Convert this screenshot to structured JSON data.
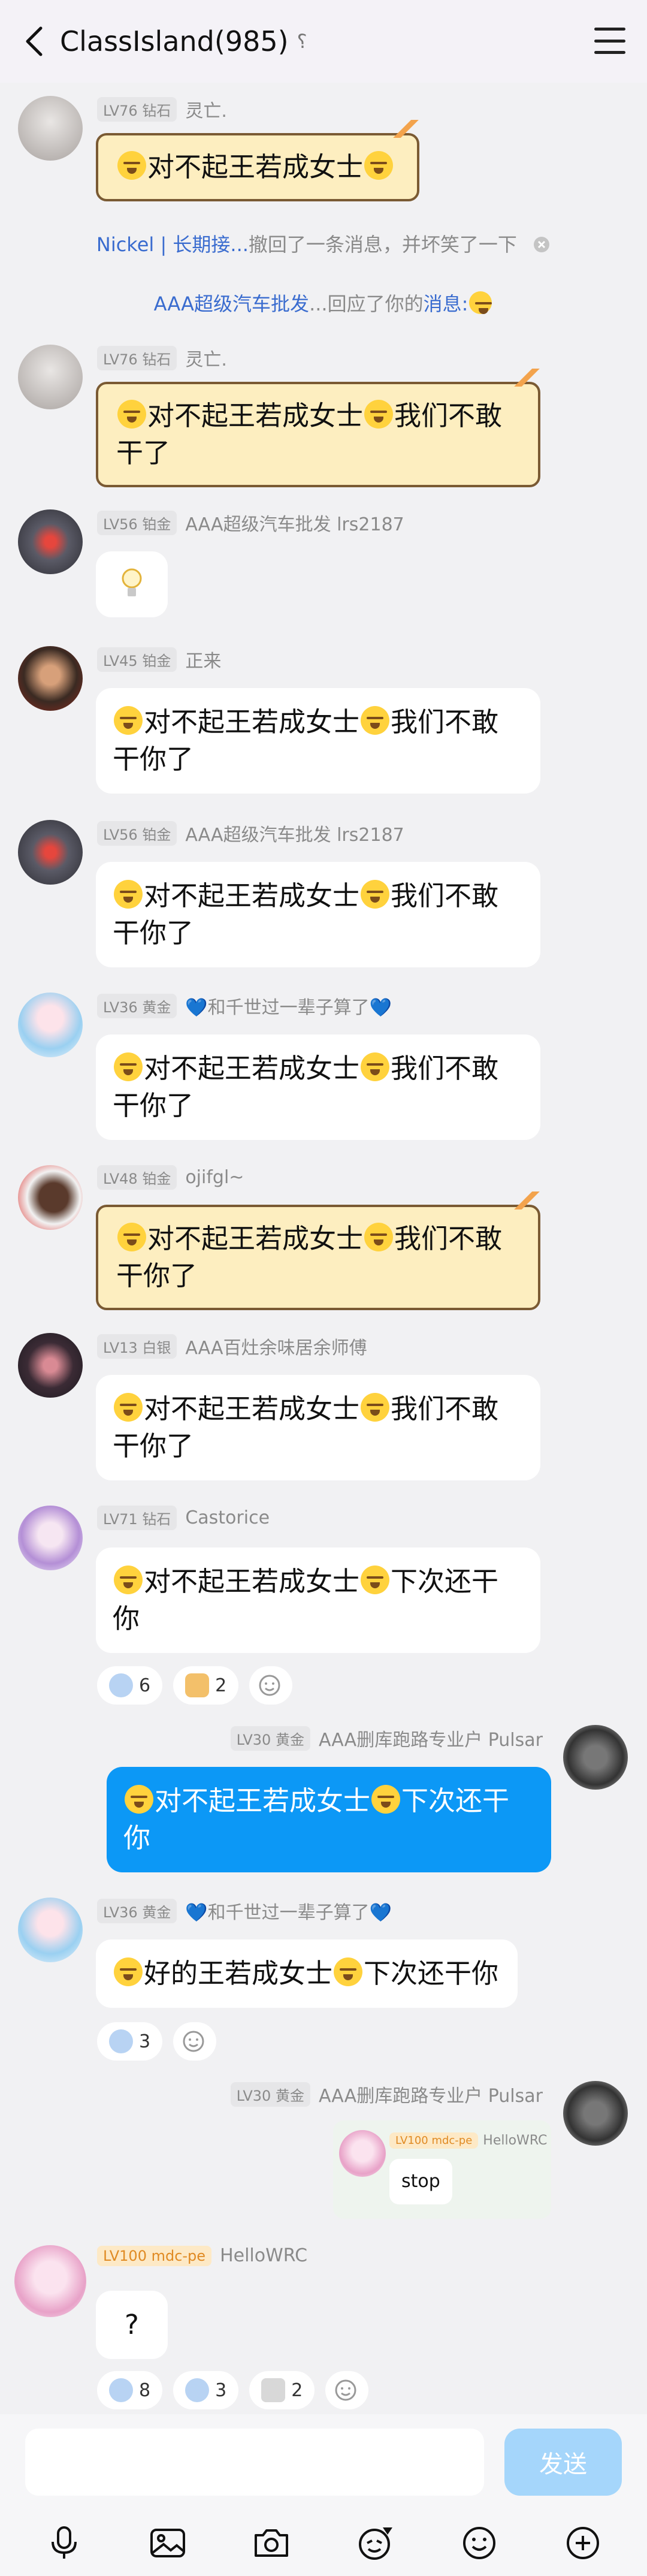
{
  "header": {
    "title": "ClassIsland(985)",
    "note_glyph": "⸮"
  },
  "emoji_name": "crying-emoji",
  "messages": [
    {
      "level": "LV76 钻石",
      "name": "灵亡.",
      "text_a": "对不起王若成女士",
      "text_b": ""
    },
    {
      "level": "LV76 钻石",
      "name": "灵亡.",
      "text_a": "对不起王若成女士",
      "text_b": "我们不敢",
      "text_c": "干了"
    },
    {
      "level": "LV56 铂金",
      "name": "AAA超级汽车批发 lrs2187"
    },
    {
      "level": "LV45 铂金",
      "name": "正来",
      "text_a": "对不起王若成女士",
      "text_b": "我们不敢",
      "text_c": "干你了"
    },
    {
      "level": "LV56 铂金",
      "name": "AAA超级汽车批发 lrs2187",
      "text_a": "对不起王若成女士",
      "text_b": "我们不敢",
      "text_c": "干你了"
    },
    {
      "level": "LV36 黄金",
      "name": "💙和千世过一辈子算了💙",
      "text_a": "对不起王若成女士",
      "text_b": "我们不敢",
      "text_c": "干你了"
    },
    {
      "level": "LV48 铂金",
      "name": "ojifgl~",
      "text_a": "对不起王若成女士",
      "text_b": "我们不敢",
      "text_c": "干你了"
    },
    {
      "level": "LV13 白银",
      "name": "AAA百灶余味居余师傅",
      "text_a": "对不起王若成女士",
      "text_b": "我们不敢",
      "text_c": "干你了"
    },
    {
      "level": "LV71 钻石",
      "name": "Castorice",
      "text_a": "对不起王若成女士",
      "text_b": "下次还干",
      "text_c": "你"
    },
    {
      "level": "LV30 黄金",
      "name": "AAA删库跑路专业户 Pulsar",
      "text_a": "对不起王若成女士",
      "text_b": "下次还干",
      "text_c": "你"
    },
    {
      "level": "LV36 黄金",
      "name": "💙和千世过一辈子算了💙",
      "text_a": "好的王若成女士",
      "text_b": "下次还干你"
    },
    {
      "level": "LV30 黄金",
      "name": "AAA删库跑路专业户 Pulsar",
      "quote_level": "LV100 mdc-pe",
      "quote_name": "HelloWRC",
      "quote_text": "stop"
    },
    {
      "level": "LV100 mdc-pe",
      "name": "HelloWRC",
      "text_a": "?"
    }
  ],
  "system": [
    {
      "link": "Nickel | 长期接...",
      "rest": "撤回了一条消息，并坏笑了一下"
    },
    {
      "link": "AAA超级汽车批发",
      "rest": "...回应了你的",
      "tail": "消息:"
    }
  ],
  "reactions": {
    "r1": [
      "6",
      "2"
    ],
    "r2": [
      "3"
    ],
    "r3": [
      "8",
      "3",
      "2"
    ]
  },
  "composer": {
    "placeholder": "",
    "send_label": "发送"
  },
  "toolbar": [
    "mic-icon",
    "image-icon",
    "camera-icon",
    "sticker-icon",
    "emoji-icon",
    "plus-icon"
  ]
}
